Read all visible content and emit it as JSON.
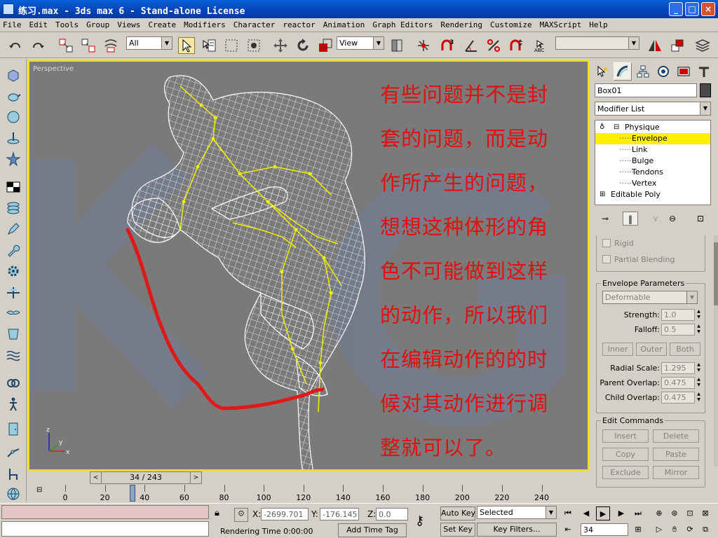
{
  "window": {
    "title": "练习.max - 3ds max 6 - Stand-alone License",
    "minimize": "_",
    "maximize": "□",
    "close": "×"
  },
  "menu": [
    "File",
    "Edit",
    "Tools",
    "Group",
    "Views",
    "Create",
    "Modifiers",
    "Character",
    "reactor",
    "Animation",
    "Graph Editors",
    "Rendering",
    "Customize",
    "MAXScript",
    "Help"
  ],
  "toolbar": {
    "selection_filter": "All",
    "reference_coord": "View",
    "named_selection": "",
    "icons": [
      "undo-icon",
      "redo-icon",
      "select-link-icon",
      "unlink-icon",
      "bind-spacewarp-icon",
      "select-object-icon",
      "select-by-name-icon",
      "region-select-icon",
      "window-crossing-icon",
      "move-icon",
      "rotate-icon",
      "scale-icon",
      "pivot-icon",
      "manipulate-icon",
      "snap-3d-icon",
      "angle-snap-icon",
      "percent-snap-icon",
      "spinner-snap-icon",
      "edit-named-selections-icon",
      "mirror-icon",
      "align-icon",
      "layer-manager-icon"
    ]
  },
  "viewport": {
    "label": "Perspective",
    "annotation_lines": [
      "有些问题并不是封",
      "套的问题，而是动",
      "作所产生的问题，",
      "想想这种体形的角",
      "色不可能做到这样",
      "的动作，所以我们",
      "在编辑动作的的时",
      "候对其动作进行调",
      "整就可以了。"
    ],
    "annotation_color": "#e01010",
    "border_color": "#f0e000",
    "mesh_color": "#ffffff",
    "bone_color": "#f0f000",
    "axis": {
      "x": "x",
      "y": "y",
      "z": "z"
    }
  },
  "command_panel": {
    "object_name": "Box01",
    "modifier_list": "Modifier List",
    "stack": [
      {
        "label": "Physique",
        "level": 0,
        "selected": false
      },
      {
        "label": "Envelope",
        "level": 1,
        "selected": true
      },
      {
        "label": "Link",
        "level": 1,
        "selected": false
      },
      {
        "label": "Bulge",
        "level": 1,
        "selected": false
      },
      {
        "label": "Tendons",
        "level": 1,
        "selected": false
      },
      {
        "label": "Vertex",
        "level": 1,
        "selected": false
      },
      {
        "label": "Editable Poly",
        "level": 0,
        "selected": false
      }
    ],
    "rigid_label": "Rigid",
    "partial_blending_label": "Partial Blending",
    "envelope_parameters": {
      "title": "Envelope Parameters",
      "type": "Deformable",
      "strength_label": "Strength:",
      "strength": "1.0",
      "falloff_label": "Falloff:",
      "falloff": "0.5",
      "inner": "Inner",
      "outer": "Outer",
      "both": "Both",
      "radial_scale_label": "Radial Scale:",
      "radial_scale": "1.295",
      "parent_overlap_label": "Parent Overlap:",
      "parent_overlap": "0.475",
      "child_overlap_label": "Child Overlap:",
      "child_overlap": "0.475"
    },
    "edit_commands": {
      "title": "Edit Commands",
      "insert": "Insert",
      "delete": "Delete",
      "copy": "Copy",
      "paste": "Paste",
      "exclude": "Exclude",
      "mirror": "Mirror"
    }
  },
  "timeline": {
    "frame_display": "34 / 243",
    "ticks": [
      "0",
      "20",
      "40",
      "60",
      "80",
      "100",
      "120",
      "140",
      "160",
      "180",
      "200",
      "220",
      "240"
    ],
    "current_frame": 34,
    "total_frames": 243
  },
  "status": {
    "x_label": "X:",
    "x": "-2699.701",
    "y_label": "Y:",
    "y": "-176.145",
    "z_label": "Z:",
    "z": "0.0",
    "rendering_time": "Rendering Time  0:00:00",
    "add_time_tag": "Add Time Tag",
    "auto_key": "Auto Key",
    "set_key": "Set Key",
    "selected": "Selected",
    "key_filters": "Key Filters...",
    "frame_field": "34"
  }
}
